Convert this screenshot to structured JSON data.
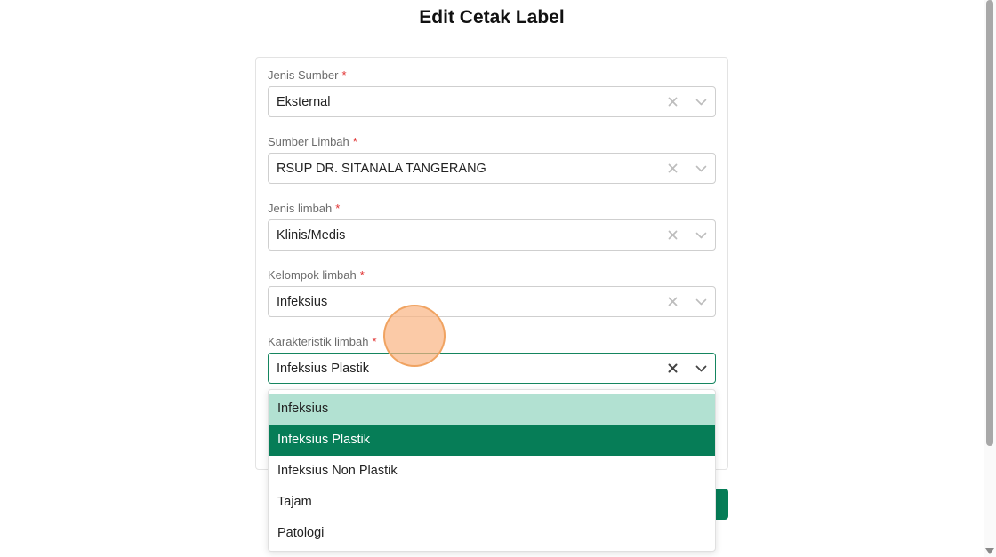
{
  "page": {
    "title": "Edit Cetak Label"
  },
  "form": {
    "required_mark": "*",
    "fields": [
      {
        "label": "Jenis Sumber",
        "value": "Eksternal"
      },
      {
        "label": "Sumber Limbah",
        "value": "RSUP DR. SITANALA TANGERANG"
      },
      {
        "label": "Jenis limbah",
        "value": "Klinis/Medis"
      },
      {
        "label": "Kelompok limbah",
        "value": "Infeksius"
      },
      {
        "label": "Karakteristik limbah",
        "value": "Infeksius Plastik"
      }
    ]
  },
  "dropdown": {
    "options": [
      "Infeksius",
      "Infeksius Plastik",
      "Infeksius Non Plastik",
      "Tajam",
      "Patologi"
    ],
    "selected": "Infeksius Plastik",
    "hovered": "Infeksius"
  },
  "icons": {
    "clear": "close-icon",
    "toggle": "chevron-down-icon"
  },
  "colors": {
    "accent": "#067d57",
    "hover": "#b2e1d2",
    "required": "#e03131"
  }
}
